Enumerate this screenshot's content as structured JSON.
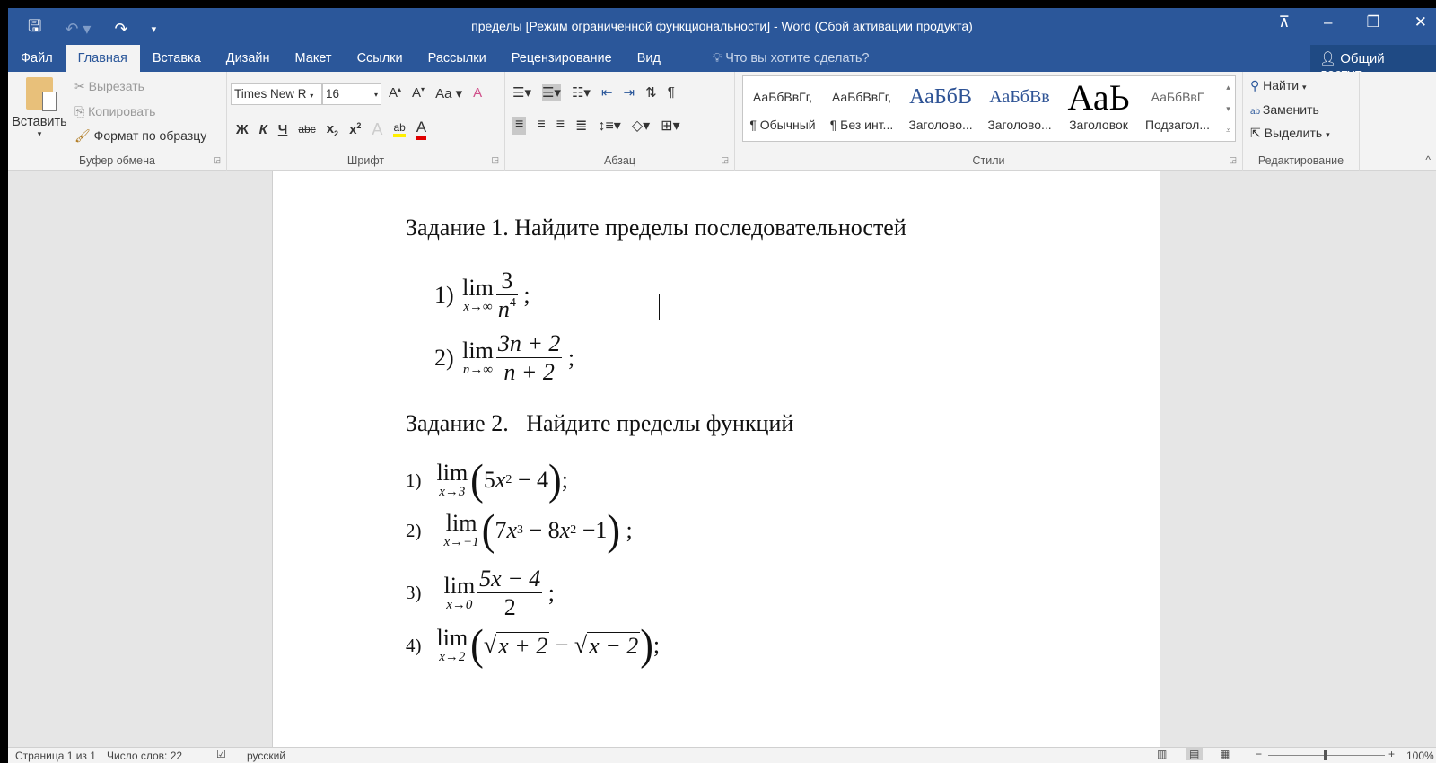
{
  "titlebar": {
    "title": "пределы [Режим ограниченной функциональности] - Word (Сбой активации продукта)",
    "share": "Общий доступ",
    "tell_me": "Что вы хотите сделать?"
  },
  "tabs": [
    "Файл",
    "Главная",
    "Вставка",
    "Дизайн",
    "Макет",
    "Ссылки",
    "Рассылки",
    "Рецензирование",
    "Вид"
  ],
  "clipboard": {
    "paste": "Вставить",
    "cut": "Вырезать",
    "copy": "Копировать",
    "format_painter": "Формат по образцу",
    "label": "Буфер обмена"
  },
  "font": {
    "name": "Times New R",
    "size": "16",
    "bold": "Ж",
    "italic": "К",
    "underline": "Ч",
    "strike": "abc",
    "case": "Aa",
    "label": "Шрифт"
  },
  "paragraph": {
    "label": "Абзац"
  },
  "styles": {
    "label": "Стили",
    "items": [
      {
        "preview": "АаБбВвГг,",
        "name": "¶ Обычный"
      },
      {
        "preview": "АаБбВвГг,",
        "name": "¶ Без инт..."
      },
      {
        "preview": "АаБбВ",
        "name": "Заголово..."
      },
      {
        "preview": "АаБбВв",
        "name": "Заголово..."
      },
      {
        "preview": "АаЬ",
        "name": "Заголовок"
      },
      {
        "preview": "АаБбВвГ",
        "name": "Подзагол..."
      }
    ]
  },
  "editing": {
    "find": "Найти",
    "replace": "Заменить",
    "select": "Выделить",
    "label": "Редактирование"
  },
  "document": {
    "task1": "Задание 1. Найдите пределы последовательностей",
    "t1": [
      {
        "n": "1)",
        "sub": "x→∞",
        "num": "3",
        "den": "n",
        "den_sup": "4",
        "end": ";"
      },
      {
        "n": "2)",
        "sub": "n→∞",
        "num": "3n + 2",
        "den": "n + 2",
        "end": ";"
      }
    ],
    "task2": "Задание 2.   Найдите пределы функций",
    "t2": [
      {
        "n": "1)",
        "sub": "x→3",
        "a": "5",
        "x": "x",
        "p": "2",
        "rest": " − 4",
        "end": ";"
      },
      {
        "n": "2)",
        "sub": "x→−1",
        "a": "7",
        "x": "x",
        "p": "3",
        "b": " − 8",
        "x2": "x",
        "p2": "2",
        "rest": " −1",
        "end": ";"
      },
      {
        "n": "3)",
        "sub": "x→0",
        "num": "5x − 4",
        "den": "2",
        "end": ";"
      },
      {
        "n": "4)",
        "sub": "x→2",
        "r1": "x + 2",
        "mid": " − ",
        "r2": "x − 2",
        "end": ";"
      }
    ],
    "lim": "lim"
  },
  "status": {
    "page": "Страница 1 из 1",
    "words": "Число слов: 22",
    "lang": "русский",
    "zoom": "100%"
  }
}
